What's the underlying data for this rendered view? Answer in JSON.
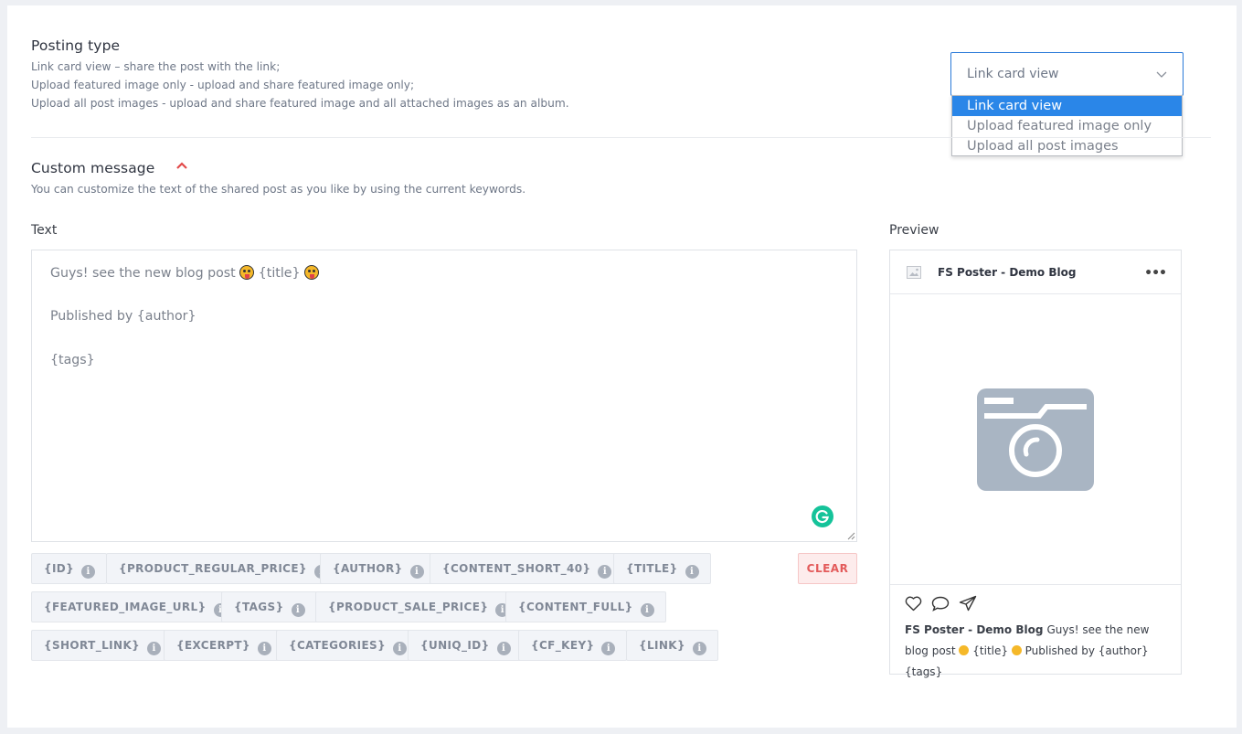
{
  "posting_type": {
    "title": "Posting type",
    "desc_lines": [
      "Link card view – share the post with the link;",
      "Upload featured image only - upload and share featured image only;",
      "Upload all post images - upload and share featured image and all attached images as an album."
    ],
    "select_value": "Link card view",
    "options": [
      "Link card view",
      "Upload featured image only",
      "Upload all post images"
    ]
  },
  "custom_message": {
    "title": "Custom message",
    "desc": "You can customize the text of the shared post as you like by using the current keywords."
  },
  "text_editor": {
    "label": "Text",
    "line1_pre": "Guys! see the new blog post ",
    "line1_mid": " {title} ",
    "line2": "Published by {author}",
    "line3": "{tags}"
  },
  "keywords": {
    "row1": [
      "{ID}",
      "{PRODUCT_REGULAR_PRICE}",
      "{AUTHOR}",
      "{CONTENT_SHORT_40}",
      "{TITLE}"
    ],
    "row2": [
      "{FEATURED_IMAGE_URL}",
      "{TAGS}",
      "{PRODUCT_SALE_PRICE}",
      "{CONTENT_FULL}"
    ],
    "row3": [
      "{SHORT_LINK}",
      "{EXCERPT}",
      "{CATEGORIES}",
      "{UNIQ_ID}",
      "{CF_KEY}",
      "{LINK}"
    ],
    "info_glyph": "i",
    "clear_label": "CLEAR"
  },
  "preview": {
    "label": "Preview",
    "account_name": "FS Poster - Demo Blog",
    "more_glyph": "•••",
    "caption_name": "FS Poster - Demo Blog",
    "caption_pre": "Guys! see the new blog post ",
    "caption_mid": " {title} ",
    "caption_post": " Published by {author} {tags}"
  },
  "colors": {
    "accent": "#2a86e8",
    "clear_text": "#e35b5b",
    "caret": "#e24b4b",
    "grammarly": "#15c39a",
    "placeholder_image": "#a9b5c3"
  }
}
